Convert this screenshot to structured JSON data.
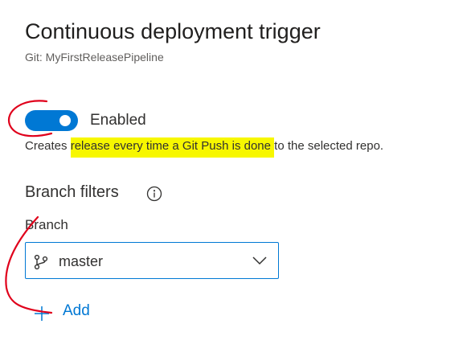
{
  "header": {
    "title": "Continuous deployment trigger",
    "subtitle": "Git: MyFirstReleasePipeline"
  },
  "trigger": {
    "enabled": true,
    "toggle_label": "Enabled",
    "description_prefix": "Creates ",
    "description_highlight": "release every time a Git Push is done ",
    "description_suffix": "to the selected repo."
  },
  "branch_filters": {
    "title": "Branch filters",
    "info_icon": "info-icon",
    "field_label": "Branch",
    "selected_branch": "master",
    "branch_icon": "branch-icon",
    "add_label": "Add"
  },
  "colors": {
    "accent": "#0078d4",
    "highlight": "#f7f700",
    "annotation": "#e0001b"
  }
}
